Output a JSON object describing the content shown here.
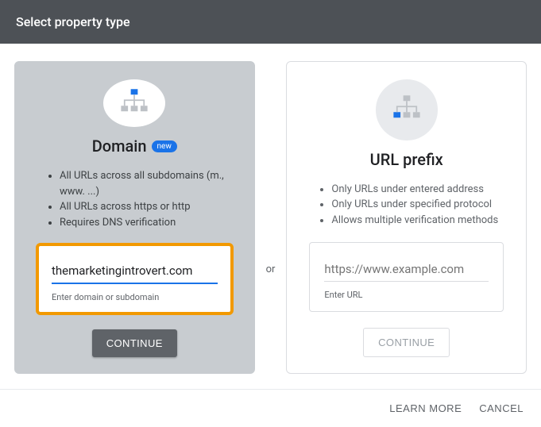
{
  "header": {
    "title": "Select property type"
  },
  "separator": "or",
  "domain_card": {
    "title": "Domain",
    "badge": "new",
    "bullets": [
      "All URLs across all subdomains (m., www. ...)",
      "All URLs across https or http",
      "Requires DNS verification"
    ],
    "input_value": "themarketingintrovert.com",
    "input_caption": "Enter domain or subdomain",
    "button": "CONTINUE"
  },
  "urlprefix_card": {
    "title": "URL prefix",
    "bullets": [
      "Only URLs under entered address",
      "Only URLs under specified protocol",
      "Allows multiple verification methods"
    ],
    "input_placeholder": "https://www.example.com",
    "input_caption": "Enter URL",
    "button": "CONTINUE"
  },
  "footer": {
    "learn_more": "LEARN MORE",
    "cancel": "CANCEL"
  }
}
